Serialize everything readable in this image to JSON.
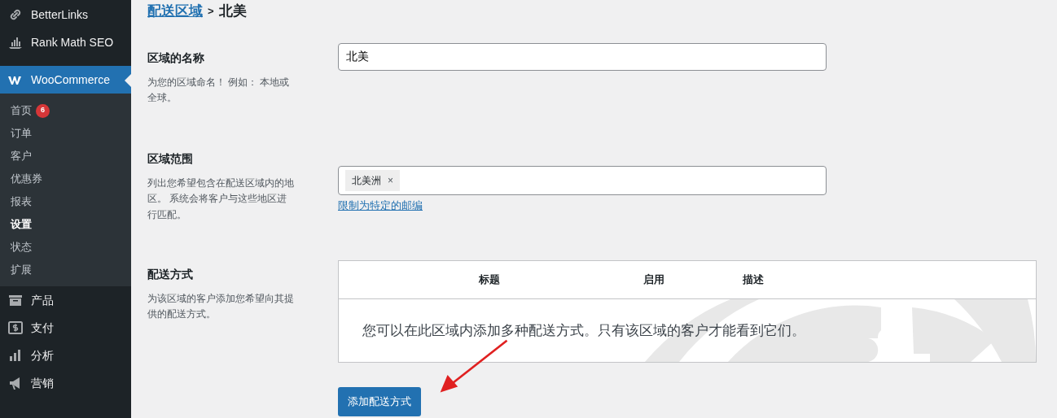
{
  "sidebar": {
    "items": [
      {
        "label": "BetterLinks",
        "selected": false
      },
      {
        "label": "Rank Math SEO",
        "selected": false
      },
      {
        "label": "WooCommerce",
        "selected": true,
        "children": [
          {
            "label": "首页",
            "selected": false,
            "badge": "6"
          },
          {
            "label": "订单",
            "selected": false
          },
          {
            "label": "客户",
            "selected": false
          },
          {
            "label": "优惠券",
            "selected": false
          },
          {
            "label": "报表",
            "selected": false
          },
          {
            "label": "设置",
            "selected": true
          },
          {
            "label": "状态",
            "selected": false
          },
          {
            "label": "扩展",
            "selected": false
          }
        ]
      },
      {
        "label": "产品",
        "selected": false
      },
      {
        "label": "支付",
        "selected": false
      },
      {
        "label": "分析",
        "selected": false
      },
      {
        "label": "营销",
        "selected": false
      }
    ]
  },
  "breadcrumb": {
    "link": "配送区域",
    "separator": ">",
    "current": "北美"
  },
  "sections": [
    {
      "kind": "text",
      "title": "区域的名称",
      "description": "为您的区域命名！ 例如： 本地或全球。",
      "value": "北美"
    },
    {
      "kind": "tags",
      "title": "区域范围",
      "description": "列出您希望包含在配送区域内的地区。 系统会将客户与这些地区进行匹配。",
      "tags": [
        {
          "label": "北美洲",
          "remove": "×"
        }
      ],
      "link": "限制为特定的邮编"
    },
    {
      "kind": "table",
      "title": "配送方式",
      "description": "为该区域的客户添加您希望向其提供的配送方式。",
      "columns": [
        "标题",
        "启用",
        "描述"
      ],
      "empty_text": "您可以在此区域内添加多种配送方式。只有该区域的客户才能看到它们。",
      "button": "添加配送方式"
    }
  ]
}
